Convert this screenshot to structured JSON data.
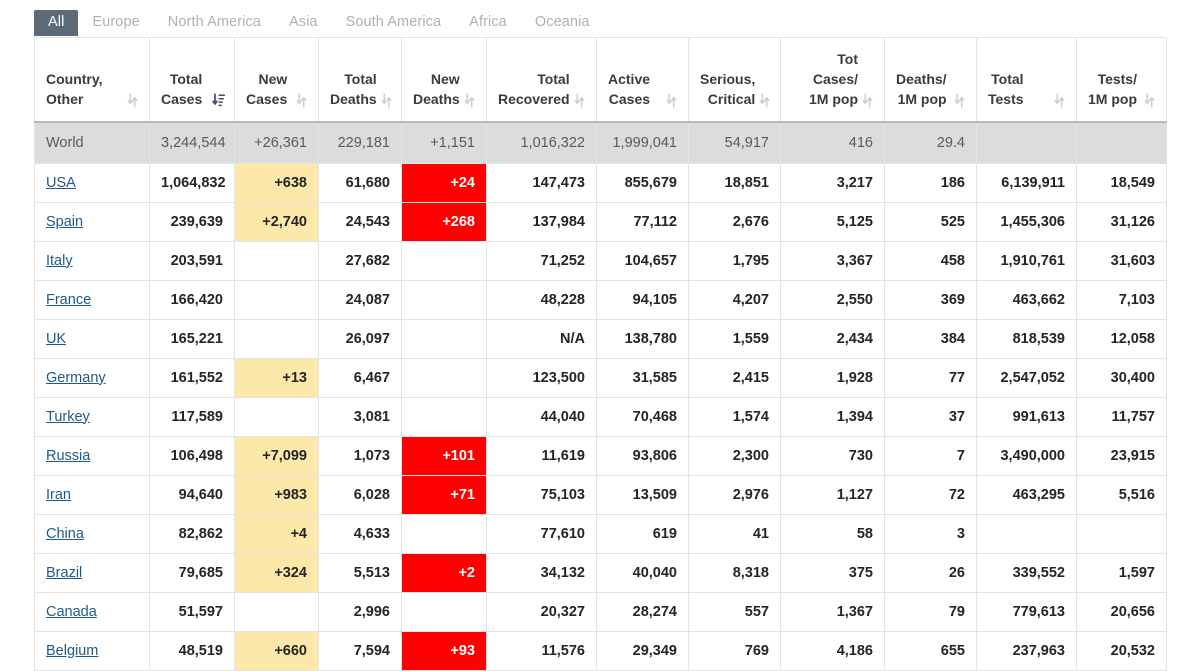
{
  "tabs": [
    {
      "label": "All",
      "active": true
    },
    {
      "label": "Europe",
      "active": false
    },
    {
      "label": "North America",
      "active": false
    },
    {
      "label": "Asia",
      "active": false
    },
    {
      "label": "South America",
      "active": false
    },
    {
      "label": "Africa",
      "active": false
    },
    {
      "label": "Oceania",
      "active": false
    }
  ],
  "colors": {
    "active_tab_bg": "#5d6b78",
    "new_case_highlight": "#fce8a8",
    "new_death_highlight": "#ff0000",
    "world_row_bg": "#dcdcdc",
    "country_link": "#1f5a8a"
  },
  "table": {
    "columns": [
      {
        "label": "Country,\nOther",
        "key": "country",
        "sort": "both",
        "align": "left"
      },
      {
        "label": "Total\nCases",
        "key": "total_cases",
        "sort": "desc-active",
        "align": "right"
      },
      {
        "label": "New\nCases",
        "key": "new_cases",
        "sort": "both",
        "align": "right"
      },
      {
        "label": "Total\nDeaths",
        "key": "total_deaths",
        "sort": "both",
        "align": "right"
      },
      {
        "label": "New\nDeaths",
        "key": "new_deaths",
        "sort": "both",
        "align": "right"
      },
      {
        "label": "Total\nRecovered",
        "key": "total_recovered",
        "sort": "both",
        "align": "right"
      },
      {
        "label": "Active\nCases",
        "key": "active_cases",
        "sort": "both",
        "align": "right"
      },
      {
        "label": "Serious,\nCritical",
        "key": "serious_critical",
        "sort": "both",
        "align": "right"
      },
      {
        "label": "Tot Cases/\n1M pop",
        "key": "tot_cases_1m",
        "sort": "both",
        "align": "right"
      },
      {
        "label": "Deaths/\n1M pop",
        "key": "deaths_1m",
        "sort": "both",
        "align": "right"
      },
      {
        "label": "Total\nTests",
        "key": "total_tests",
        "sort": "both",
        "align": "right"
      },
      {
        "label": "Tests/\n1M pop",
        "key": "tests_1m",
        "sort": "both",
        "align": "right"
      }
    ],
    "world_row": {
      "country": "World",
      "total_cases": "3,244,544",
      "new_cases": "+26,361",
      "total_deaths": "229,181",
      "new_deaths": "+1,151",
      "total_recovered": "1,016,322",
      "active_cases": "1,999,041",
      "serious_critical": "54,917",
      "tot_cases_1m": "416",
      "deaths_1m": "29.4",
      "total_tests": "",
      "tests_1m": ""
    },
    "rows": [
      {
        "country": "USA",
        "total_cases": "1,064,832",
        "new_cases": "+638",
        "total_deaths": "61,680",
        "new_deaths": "+24",
        "total_recovered": "147,473",
        "active_cases": "855,679",
        "serious_critical": "18,851",
        "tot_cases_1m": "3,217",
        "deaths_1m": "186",
        "total_tests": "6,139,911",
        "tests_1m": "18,549"
      },
      {
        "country": "Spain",
        "total_cases": "239,639",
        "new_cases": "+2,740",
        "total_deaths": "24,543",
        "new_deaths": "+268",
        "total_recovered": "137,984",
        "active_cases": "77,112",
        "serious_critical": "2,676",
        "tot_cases_1m": "5,125",
        "deaths_1m": "525",
        "total_tests": "1,455,306",
        "tests_1m": "31,126"
      },
      {
        "country": "Italy",
        "total_cases": "203,591",
        "new_cases": "",
        "total_deaths": "27,682",
        "new_deaths": "",
        "total_recovered": "71,252",
        "active_cases": "104,657",
        "serious_critical": "1,795",
        "tot_cases_1m": "3,367",
        "deaths_1m": "458",
        "total_tests": "1,910,761",
        "tests_1m": "31,603"
      },
      {
        "country": "France",
        "total_cases": "166,420",
        "new_cases": "",
        "total_deaths": "24,087",
        "new_deaths": "",
        "total_recovered": "48,228",
        "active_cases": "94,105",
        "serious_critical": "4,207",
        "tot_cases_1m": "2,550",
        "deaths_1m": "369",
        "total_tests": "463,662",
        "tests_1m": "7,103"
      },
      {
        "country": "UK",
        "total_cases": "165,221",
        "new_cases": "",
        "total_deaths": "26,097",
        "new_deaths": "",
        "total_recovered": "N/A",
        "active_cases": "138,780",
        "serious_critical": "1,559",
        "tot_cases_1m": "2,434",
        "deaths_1m": "384",
        "total_tests": "818,539",
        "tests_1m": "12,058"
      },
      {
        "country": "Germany",
        "total_cases": "161,552",
        "new_cases": "+13",
        "total_deaths": "6,467",
        "new_deaths": "",
        "total_recovered": "123,500",
        "active_cases": "31,585",
        "serious_critical": "2,415",
        "tot_cases_1m": "1,928",
        "deaths_1m": "77",
        "total_tests": "2,547,052",
        "tests_1m": "30,400"
      },
      {
        "country": "Turkey",
        "total_cases": "117,589",
        "new_cases": "",
        "total_deaths": "3,081",
        "new_deaths": "",
        "total_recovered": "44,040",
        "active_cases": "70,468",
        "serious_critical": "1,574",
        "tot_cases_1m": "1,394",
        "deaths_1m": "37",
        "total_tests": "991,613",
        "tests_1m": "11,757"
      },
      {
        "country": "Russia",
        "total_cases": "106,498",
        "new_cases": "+7,099",
        "total_deaths": "1,073",
        "new_deaths": "+101",
        "total_recovered": "11,619",
        "active_cases": "93,806",
        "serious_critical": "2,300",
        "tot_cases_1m": "730",
        "deaths_1m": "7",
        "total_tests": "3,490,000",
        "tests_1m": "23,915"
      },
      {
        "country": "Iran",
        "total_cases": "94,640",
        "new_cases": "+983",
        "total_deaths": "6,028",
        "new_deaths": "+71",
        "total_recovered": "75,103",
        "active_cases": "13,509",
        "serious_critical": "2,976",
        "tot_cases_1m": "1,127",
        "deaths_1m": "72",
        "total_tests": "463,295",
        "tests_1m": "5,516"
      },
      {
        "country": "China",
        "total_cases": "82,862",
        "new_cases": "+4",
        "total_deaths": "4,633",
        "new_deaths": "",
        "total_recovered": "77,610",
        "active_cases": "619",
        "serious_critical": "41",
        "tot_cases_1m": "58",
        "deaths_1m": "3",
        "total_tests": "",
        "tests_1m": ""
      },
      {
        "country": "Brazil",
        "total_cases": "79,685",
        "new_cases": "+324",
        "total_deaths": "5,513",
        "new_deaths": "+2",
        "total_recovered": "34,132",
        "active_cases": "40,040",
        "serious_critical": "8,318",
        "tot_cases_1m": "375",
        "deaths_1m": "26",
        "total_tests": "339,552",
        "tests_1m": "1,597"
      },
      {
        "country": "Canada",
        "total_cases": "51,597",
        "new_cases": "",
        "total_deaths": "2,996",
        "new_deaths": "",
        "total_recovered": "20,327",
        "active_cases": "28,274",
        "serious_critical": "557",
        "tot_cases_1m": "1,367",
        "deaths_1m": "79",
        "total_tests": "779,613",
        "tests_1m": "20,656"
      },
      {
        "country": "Belgium",
        "total_cases": "48,519",
        "new_cases": "+660",
        "total_deaths": "7,594",
        "new_deaths": "+93",
        "total_recovered": "11,576",
        "active_cases": "29,349",
        "serious_critical": "769",
        "tot_cases_1m": "4,186",
        "deaths_1m": "655",
        "total_tests": "237,963",
        "tests_1m": "20,532"
      }
    ]
  }
}
